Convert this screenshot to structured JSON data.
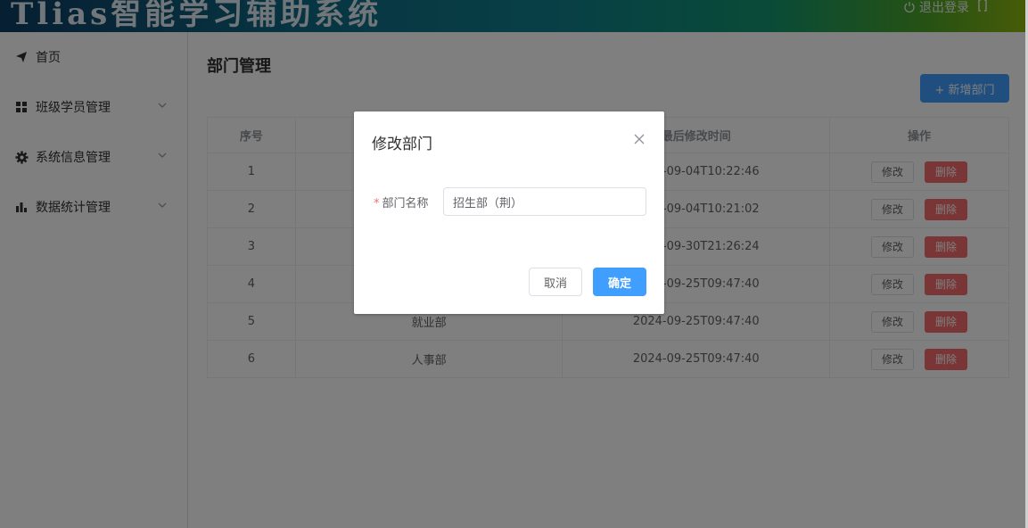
{
  "header": {
    "app_title": "Tlias智能学习辅助系统",
    "logout_label": "退出登录",
    "toggle_glyph": "⦆⦅"
  },
  "sidebar": {
    "items": [
      {
        "label": "首页",
        "icon": "send-icon"
      },
      {
        "label": "班级学员管理",
        "icon": "grid-icon"
      },
      {
        "label": "系统信息管理",
        "icon": "gear-icon"
      },
      {
        "label": "数据统计管理",
        "icon": "bar-chart-icon"
      }
    ]
  },
  "main": {
    "page_title": "部门管理",
    "add_button_label": "+ 新增部门",
    "table": {
      "headers": [
        "序号",
        "",
        "最后修改时间",
        "操作"
      ],
      "rows": [
        {
          "index": "1",
          "name": "",
          "time": "2024-09-04T10:22:46"
        },
        {
          "index": "2",
          "name": "",
          "time": "2024-09-04T10:21:02"
        },
        {
          "index": "3",
          "name": "",
          "time": "2024-09-30T21:26:24"
        },
        {
          "index": "4",
          "name": "",
          "time": "2024-09-25T09:47:40"
        },
        {
          "index": "5",
          "name": "就业部",
          "time": "2024-09-25T09:47:40"
        },
        {
          "index": "6",
          "name": "人事部",
          "time": "2024-09-25T09:47:40"
        }
      ],
      "edit_label": "修改",
      "delete_label": "删除"
    }
  },
  "dialog": {
    "title": "修改部门",
    "field_label": "部门名称",
    "required_mark": "*",
    "field_value": "招生部（荆）",
    "cancel_label": "取消",
    "confirm_label": "确定"
  },
  "colors": {
    "primary": "#409eff",
    "danger": "#f56c6c",
    "overlay": "rgba(0,0,0,0.5)"
  }
}
